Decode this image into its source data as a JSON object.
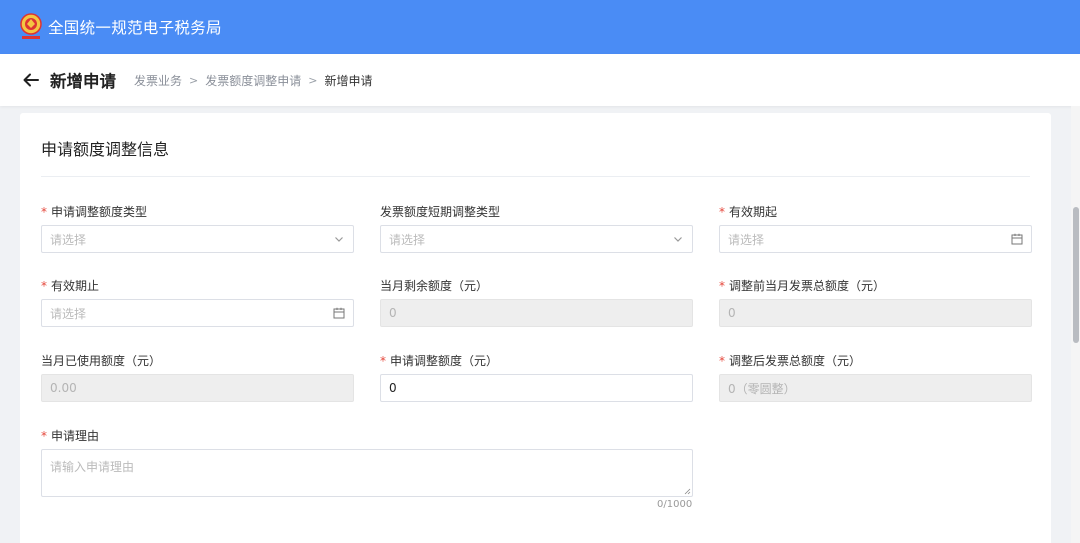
{
  "app": {
    "title": "全国统一规范电子税务局"
  },
  "header": {
    "page_title": "新增申请",
    "breadcrumb": [
      "发票业务",
      "发票额度调整申请",
      "新增申请"
    ]
  },
  "form": {
    "section_title": "申请额度调整信息",
    "fields": {
      "adjust_type": {
        "label": "申请调整额度类型",
        "required": true,
        "placeholder": "请选择"
      },
      "short_term_type": {
        "label": "发票额度短期调整类型",
        "required": false,
        "placeholder": "请选择"
      },
      "valid_from": {
        "label": "有效期起",
        "required": true,
        "placeholder": "请选择"
      },
      "valid_to": {
        "label": "有效期止",
        "required": true,
        "placeholder": "请选择"
      },
      "remaining": {
        "label": "当月剩余额度（元）",
        "required": false,
        "value": "0"
      },
      "pre_total": {
        "label": "调整前当月发票总额度（元）",
        "required": true,
        "value": "0"
      },
      "used": {
        "label": "当月已使用额度（元）",
        "required": false,
        "value": "0.00"
      },
      "adjust_amount": {
        "label": "申请调整额度（元）",
        "required": true,
        "value": "0"
      },
      "post_total": {
        "label": "调整后发票总额度（元）",
        "required": true,
        "value": "0（零圆整）"
      },
      "reason": {
        "label": "申请理由",
        "required": true,
        "placeholder": "请输入申请理由",
        "counter": "0/1000"
      }
    }
  },
  "icons": {
    "back": "arrow-left-icon",
    "select": "chevron-down-icon",
    "date": "calendar-icon",
    "logo": "tax-emblem-logo"
  },
  "colors": {
    "topbar": "#4a8cf5",
    "required_mark": "#e5483c",
    "disabled_bg": "#eeeeee"
  }
}
